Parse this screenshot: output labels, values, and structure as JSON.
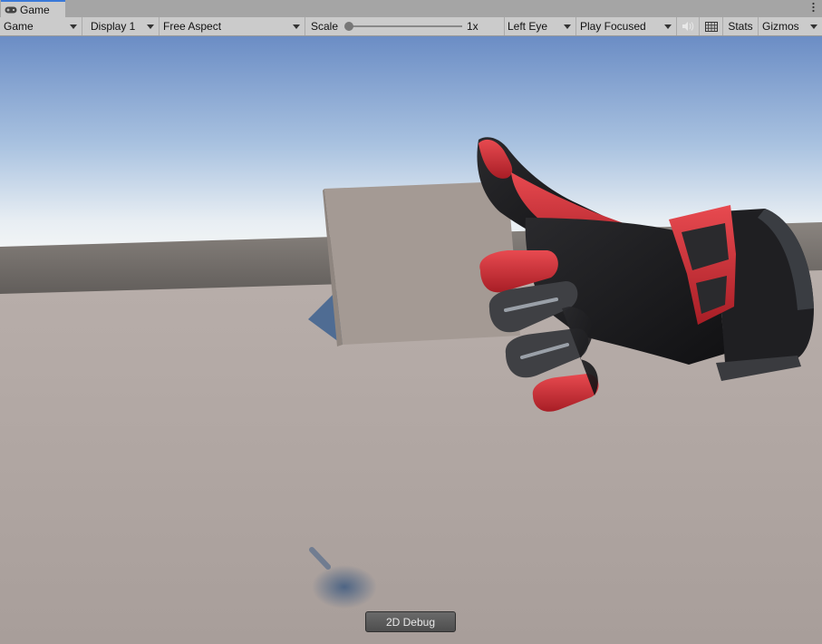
{
  "tab": {
    "title": "Game"
  },
  "toolbar": {
    "view_dropdown": "Game",
    "display_dropdown": "Display 1",
    "aspect_dropdown": "Free Aspect",
    "scale_label": "Scale",
    "scale_value": "1x",
    "scale_fraction": 0,
    "eye_dropdown": "Left Eye",
    "play_mode_dropdown": "Play Focused",
    "stats_label": "Stats",
    "gizmos_label": "Gizmos"
  },
  "overlay": {
    "debug_button_label": "2D Debug"
  },
  "colors": {
    "tab_accent": "#3a79d8",
    "glove_red": "#d02a32",
    "glove_black": "#1b1b1d",
    "floor": "#aea49f",
    "sky_top": "#6b8dc5"
  },
  "icons": [
    "gamepad-icon",
    "kebab-menu-icon",
    "speaker-mute-icon",
    "keyboard-grid-icon"
  ]
}
